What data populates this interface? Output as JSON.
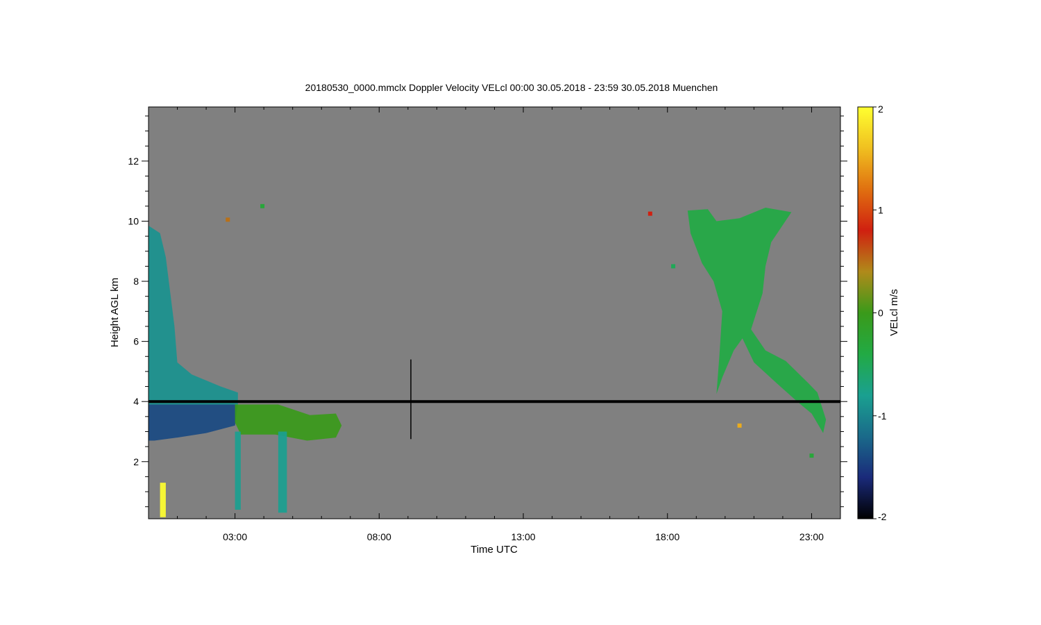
{
  "chart_data": {
    "type": "heatmap",
    "title": "20180530_0000.mmclx Doppler Velocity VELcl   00:00 30.05.2018 - 23:59 30.05.2018 Muenchen",
    "xlabel": "Time UTC",
    "ylabel": "Height AGL km",
    "xlim_hours": [
      0.0,
      24.0
    ],
    "ylim_km": [
      0.1,
      13.8
    ],
    "x_tick_labels": [
      "03:00",
      "08:00",
      "13:00",
      "18:00",
      "23:00"
    ],
    "x_tick_hours": [
      3,
      8,
      13,
      18,
      23
    ],
    "y_ticks": [
      2,
      4,
      6,
      8,
      10,
      12
    ],
    "background_color": "#808080",
    "colorbar": {
      "label": "VELcl m/s",
      "range": [
        -2,
        2
      ],
      "ticks": [
        -2,
        -1,
        0,
        1,
        2
      ],
      "colors": [
        "#000000",
        "#1a2a7a",
        "#1a6a8a",
        "#1aa090",
        "#22aa44",
        "#3a9a1a",
        "#b08a1a",
        "#d02010",
        "#e07010",
        "#f0c020",
        "#ffff30"
      ]
    },
    "constant_line": {
      "height_km": 4.0,
      "color": "#000000"
    },
    "spike": {
      "hour": 9.1,
      "from_km": 2.75,
      "to_km": 5.4
    },
    "echo_regions": [
      {
        "name": "morning cloud upper",
        "velocity": -0.9,
        "polygon": [
          [
            0.0,
            9.85
          ],
          [
            0.4,
            9.6
          ],
          [
            0.6,
            8.8
          ],
          [
            0.9,
            6.5
          ],
          [
            1.0,
            5.3
          ],
          [
            1.5,
            4.9
          ],
          [
            2.5,
            4.5
          ],
          [
            3.1,
            4.3
          ],
          [
            3.1,
            3.9
          ],
          [
            0.0,
            3.9
          ]
        ]
      },
      {
        "name": "morning cloud lower",
        "velocity": -1.4,
        "polygon": [
          [
            0.0,
            3.9
          ],
          [
            3.1,
            3.9
          ],
          [
            3.0,
            3.2
          ],
          [
            2.0,
            2.95
          ],
          [
            1.0,
            2.8
          ],
          [
            0.2,
            2.7
          ],
          [
            0.0,
            2.7
          ]
        ]
      },
      {
        "name": "midmorning layer",
        "velocity": 0.0,
        "polygon": [
          [
            3.0,
            3.9
          ],
          [
            4.5,
            3.9
          ],
          [
            5.6,
            3.55
          ],
          [
            6.5,
            3.6
          ],
          [
            6.7,
            3.2
          ],
          [
            6.5,
            2.8
          ],
          [
            5.5,
            2.7
          ],
          [
            4.4,
            2.9
          ],
          [
            3.2,
            2.9
          ],
          [
            3.0,
            3.3
          ]
        ]
      },
      {
        "name": "fall streak 1",
        "velocity": -0.8,
        "polygon": [
          [
            3.0,
            3.0
          ],
          [
            3.2,
            3.0
          ],
          [
            3.2,
            0.4
          ],
          [
            3.0,
            0.4
          ]
        ]
      },
      {
        "name": "fall streak 2",
        "velocity": -0.8,
        "polygon": [
          [
            4.5,
            3.0
          ],
          [
            4.8,
            3.0
          ],
          [
            4.8,
            0.3
          ],
          [
            4.5,
            0.3
          ]
        ]
      },
      {
        "name": "evening anvil",
        "velocity": -0.4,
        "polygon": [
          [
            18.7,
            10.35
          ],
          [
            19.4,
            10.4
          ],
          [
            19.7,
            10.0
          ],
          [
            20.5,
            10.1
          ],
          [
            21.4,
            10.45
          ],
          [
            22.3,
            10.3
          ],
          [
            21.6,
            9.3
          ],
          [
            21.4,
            8.5
          ],
          [
            21.3,
            7.6
          ],
          [
            20.9,
            6.4
          ],
          [
            21.4,
            5.7
          ],
          [
            22.1,
            5.35
          ],
          [
            22.9,
            4.6
          ],
          [
            23.2,
            4.3
          ],
          [
            23.5,
            3.4
          ],
          [
            23.4,
            2.95
          ],
          [
            23.0,
            3.6
          ],
          [
            22.5,
            4.0
          ],
          [
            21.8,
            4.6
          ],
          [
            21.0,
            5.3
          ],
          [
            20.6,
            6.1
          ],
          [
            20.3,
            5.7
          ],
          [
            19.9,
            4.8
          ],
          [
            19.7,
            4.25
          ],
          [
            19.8,
            5.5
          ],
          [
            19.9,
            7.0
          ],
          [
            19.6,
            8.0
          ],
          [
            19.2,
            8.6
          ],
          [
            18.8,
            9.6
          ]
        ]
      },
      {
        "name": "surface clutter left",
        "velocity": 2.0,
        "polygon": [
          [
            0.4,
            1.3
          ],
          [
            0.6,
            1.3
          ],
          [
            0.6,
            0.15
          ],
          [
            0.4,
            0.15
          ]
        ]
      }
    ],
    "scattered_points": [
      {
        "hour": 2.75,
        "km": 10.05,
        "velocity": 0.5
      },
      {
        "hour": 3.95,
        "km": 10.5,
        "velocity": -0.3
      },
      {
        "hour": 17.4,
        "km": 10.25,
        "velocity": 0.8
      },
      {
        "hour": 18.2,
        "km": 8.5,
        "velocity": -0.5
      },
      {
        "hour": 20.5,
        "km": 3.2,
        "velocity": 1.5
      },
      {
        "hour": 23.0,
        "km": 2.2,
        "velocity": -0.3
      }
    ]
  }
}
